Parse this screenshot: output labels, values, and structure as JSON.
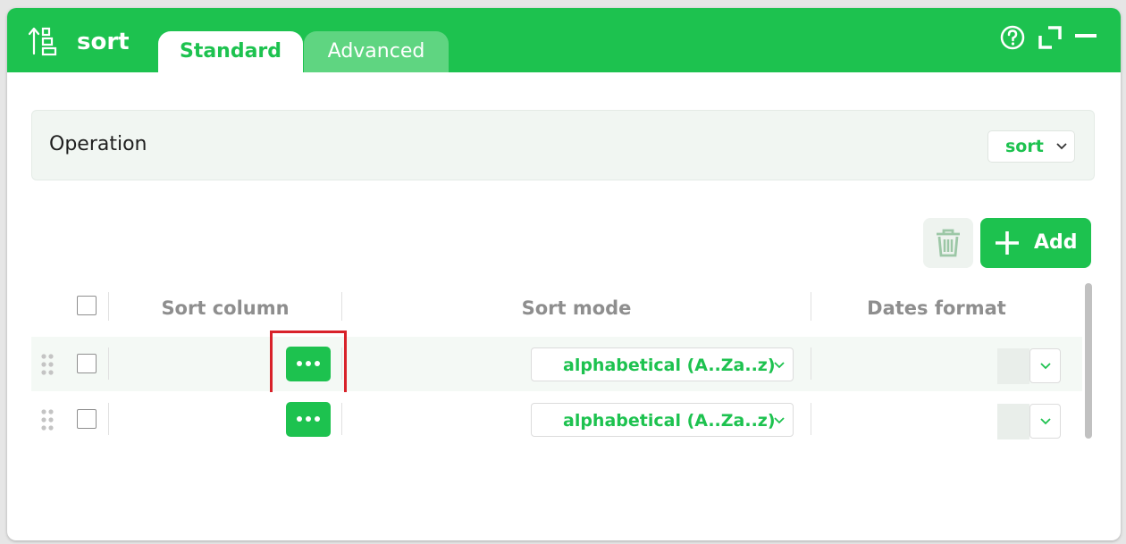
{
  "header": {
    "icon": "sort-icon",
    "title": "sort",
    "tabs": [
      {
        "label": "Standard",
        "active": true
      },
      {
        "label": "Advanced",
        "active": false
      }
    ],
    "help_icon": "help-circle-icon",
    "expand_icon": "expand-icon",
    "minimize_icon": "minimize-icon"
  },
  "operation": {
    "label": "Operation",
    "value": "sort"
  },
  "toolbar": {
    "delete_icon": "trash-icon",
    "add_label": "Add"
  },
  "table": {
    "columns": [
      "Sort column",
      "Sort mode",
      "Dates format"
    ],
    "rows": [
      {
        "sort_mode": "alphabetical (A..Za..z)",
        "dates_format": ""
      },
      {
        "sort_mode": "alphabetical (A..Za..z)",
        "dates_format": ""
      }
    ]
  },
  "colors": {
    "accent": "#1dc24f",
    "accent_light": "#5fd581",
    "highlight": "#d8222a"
  }
}
